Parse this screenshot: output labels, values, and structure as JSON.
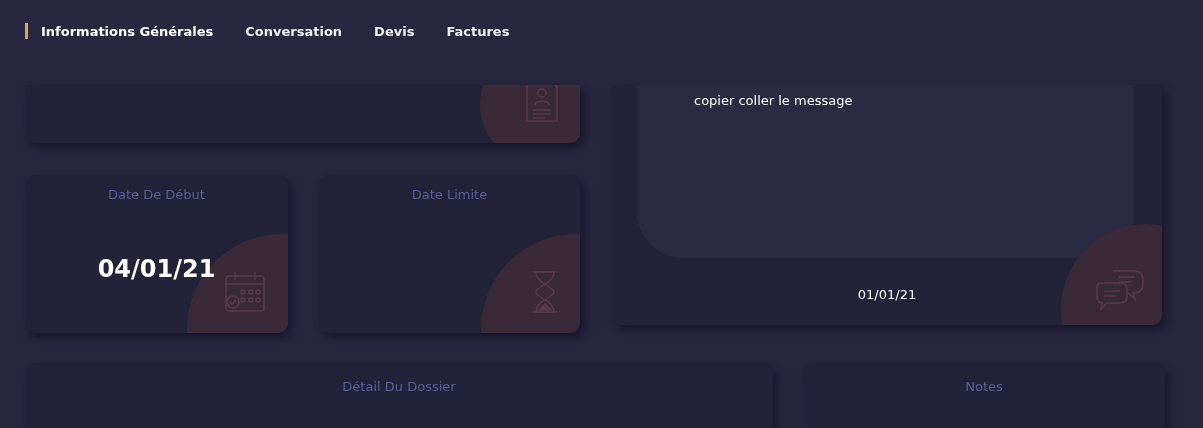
{
  "tabs": [
    {
      "label": "Informations Générales",
      "selected": true
    },
    {
      "label": "Conversation",
      "selected": false
    },
    {
      "label": "Devis",
      "selected": false
    },
    {
      "label": "Factures",
      "selected": false
    }
  ],
  "date_cards": [
    {
      "label": "Date De Début",
      "value": "04/01/21"
    },
    {
      "label": "Date Limite"
    }
  ],
  "message_card": {
    "message": "copier coller le message",
    "date": "01/01/21"
  },
  "panels": [
    {
      "title": "Détail Du Dossier"
    },
    {
      "title": "Notes"
    }
  ]
}
